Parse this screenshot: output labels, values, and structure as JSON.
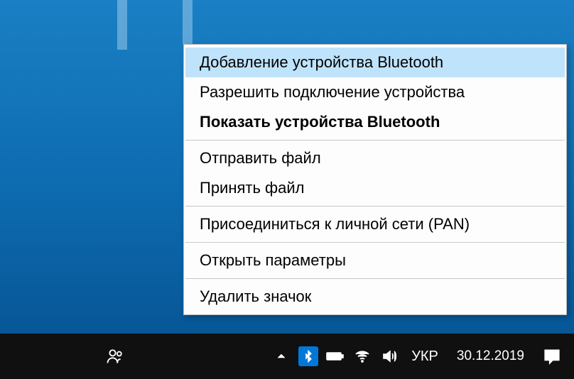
{
  "menu": {
    "add_bluetooth": "Добавление устройства Bluetooth",
    "allow_connect": "Разрешить подключение устройства",
    "show_devices": "Показать устройства Bluetooth",
    "send_file": "Отправить файл",
    "receive_file": "Принять файл",
    "join_pan": "Присоединиться к личной сети (PAN)",
    "open_settings": "Открыть параметры",
    "remove_icon": "Удалить значок"
  },
  "taskbar": {
    "language": "УКР",
    "date": "30.12.2019"
  }
}
